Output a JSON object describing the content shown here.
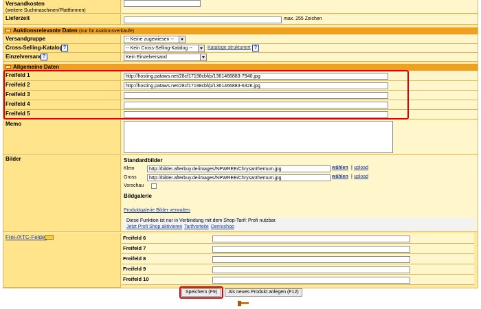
{
  "versandkosten": {
    "label": "Versandkosten",
    "sublabel": "(weitere Suchmaschinen/Plattformen)",
    "value": ""
  },
  "lieferzeit": {
    "label": "Lieferzeit",
    "value": "",
    "hint": "max. 255 Zeichen"
  },
  "auktion_section": {
    "title": "Auktionsrelevante Daten",
    "subtitle": "(nur für Auktionsverkäufe)"
  },
  "versandgruppe": {
    "label": "Versandgruppe",
    "selected": "-- Keine zugewiesen --"
  },
  "cross_selling": {
    "label": "Cross-Selling-Katalog",
    "selected": "-- Kein Cross-Selling-Katalog --",
    "link": "Kataloge strukturiert"
  },
  "einzelversand": {
    "label": "Einzelversand",
    "selected": "Kein Einzelversand"
  },
  "allgemeine_section": {
    "title": "Allgemeine Daten"
  },
  "freifelder": [
    {
      "label": "Freifeld 1",
      "value": "http://hosting.pataws.net/28cf17198cbf/p/1361466883-7940.jpg"
    },
    {
      "label": "Freifeld 2",
      "value": "http://hosting.pataws.net/28cf17198cbf/p/1361466883-6326.jpg"
    },
    {
      "label": "Freifeld 3",
      "value": ""
    },
    {
      "label": "Freifeld 4",
      "value": ""
    },
    {
      "label": "Freifeld 5",
      "value": ""
    }
  ],
  "memo": {
    "label": "Memo",
    "value": ""
  },
  "bilder": {
    "label": "Bilder",
    "heading": "Standardbilder",
    "klein_label": "Klein",
    "klein_value": "http://bilder.afterbuy.de/images/NPWREE/Chrysanthemum.jpg",
    "gross_label": "Gross",
    "gross_value": "http://bilder.afterbuy.de/images/NPWREE/Chrysanthemum.jpg",
    "waehlen": "wählen",
    "sep": "|",
    "upload": "upload",
    "vorschau_label": "Vorschau",
    "galerie_heading": "Bildgalerie",
    "galerie_link": "Produktgalerie Bilder verwalten",
    "notice": "Diese Funktion ist nur in Verbindung mit dem Shop-Tarif: Profi nutzbar.",
    "notice_link1": "Jetzt Profi Shop aktivieren",
    "notice_link2": "Tarifvorteile",
    "notice_link3": "Demoshop"
  },
  "xtc": {
    "label": "Frei-/XTC-Felder",
    "fields": [
      {
        "label": "Freifeld 6",
        "value": ""
      },
      {
        "label": "Freifeld 7",
        "value": ""
      },
      {
        "label": "Freifeld 8",
        "value": ""
      },
      {
        "label": "Freifeld 9",
        "value": ""
      },
      {
        "label": "Freifeld 10",
        "value": ""
      }
    ]
  },
  "buttons": {
    "save": "Speichern (F9)",
    "new": "Als neues Produkt anlegen (F12)"
  },
  "colors": {
    "accent_red": "#d8000c",
    "section_orange": "#f0a020",
    "label_bg": "#ffe48c",
    "link": "#1a3f9f"
  }
}
